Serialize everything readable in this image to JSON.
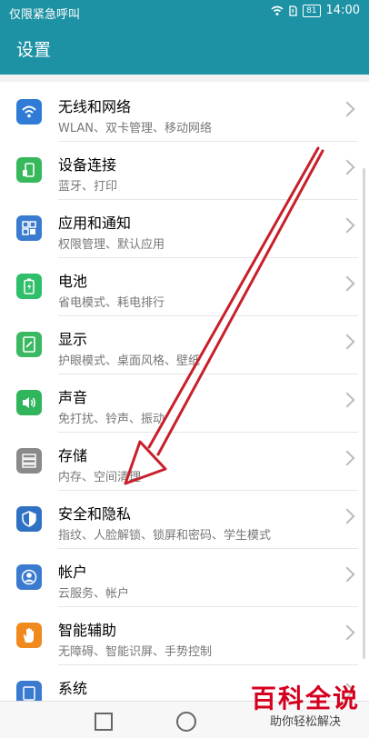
{
  "status_bar": {
    "left_text": "仅限紧急呼叫",
    "battery": "81",
    "time": "14:00"
  },
  "header": {
    "title": "设置"
  },
  "settings_items": [
    {
      "label": "无线和网络",
      "sub": "WLAN、双卡管理、移动网络",
      "color": "#2f7bd5",
      "icon": "wifi-icon"
    },
    {
      "label": "设备连接",
      "sub": "蓝牙、打印",
      "color": "#38b85c",
      "icon": "device-connect-icon"
    },
    {
      "label": "应用和通知",
      "sub": "权限管理、默认应用",
      "color": "#3a7bd0",
      "icon": "apps-icon"
    },
    {
      "label": "电池",
      "sub": "省电模式、耗电排行",
      "color": "#2fbe6a",
      "icon": "battery-icon"
    },
    {
      "label": "显示",
      "sub": "护眼模式、桌面风格、壁纸",
      "color": "#3bb862",
      "icon": "display-icon"
    },
    {
      "label": "声音",
      "sub": "免打扰、铃声、振动",
      "color": "#30b55c",
      "icon": "sound-icon"
    },
    {
      "label": "存储",
      "sub": "内存、空间清理",
      "color": "#8a8a8a",
      "icon": "storage-icon"
    },
    {
      "label": "安全和隐私",
      "sub": "指纹、人脸解锁、锁屏和密码、学生模式",
      "color": "#2f72c4",
      "icon": "shield-icon"
    },
    {
      "label": "帐户",
      "sub": "云服务、帐户",
      "color": "#3a7bd0",
      "icon": "account-icon"
    },
    {
      "label": "智能辅助",
      "sub": "无障碍、智能识屏、手势控制",
      "color": "#f08a1e",
      "icon": "hand-icon"
    },
    {
      "label": "系统",
      "sub": "",
      "color": "#3a7bd0",
      "icon": "system-icon"
    }
  ],
  "watermark": {
    "big": "百科全说",
    "small": "助你轻松解决"
  }
}
